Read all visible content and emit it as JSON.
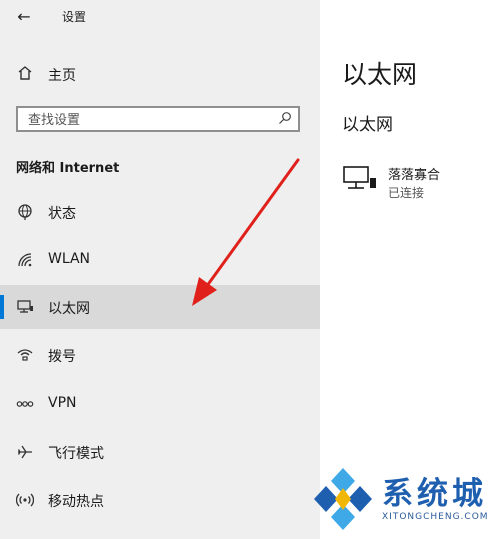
{
  "window": {
    "title": "设置"
  },
  "nav": {
    "home_label": "主页",
    "search_placeholder": "查找设置",
    "section_title": "网络和 Internet",
    "items": [
      {
        "label": "状态",
        "icon": "globe-icon"
      },
      {
        "label": "WLAN",
        "icon": "wifi-icon"
      },
      {
        "label": "以太网",
        "icon": "ethernet-icon",
        "selected": true
      },
      {
        "label": "拨号",
        "icon": "dialup-icon"
      },
      {
        "label": "VPN",
        "icon": "vpn-icon"
      },
      {
        "label": "飞行模式",
        "icon": "airplane-icon"
      },
      {
        "label": "移动热点",
        "icon": "hotspot-icon"
      }
    ]
  },
  "content": {
    "title": "以太网",
    "subtitle": "以太网",
    "network": {
      "name": "落落寡合",
      "status": "已连接"
    }
  },
  "watermark": {
    "text": "系统城",
    "sub": "XITONGCHENG.COM"
  },
  "colors": {
    "accent": "#0078d7",
    "arrow": "#e0201a",
    "watermark": "#1f5fb0"
  }
}
